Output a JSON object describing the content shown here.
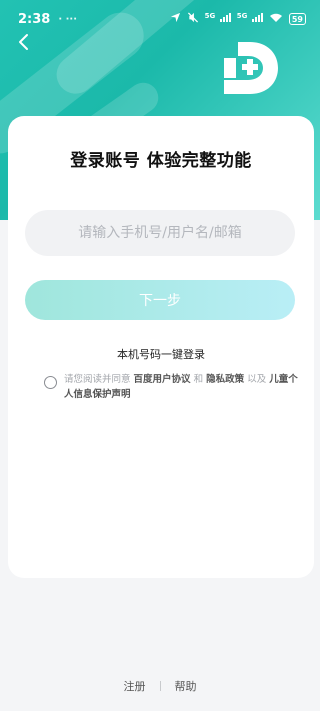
{
  "status_bar": {
    "time": "2:38",
    "indicators": "· ···",
    "network_1": "5G",
    "network_2": "5G",
    "battery": "59"
  },
  "header": {
    "back_icon": "chevron-left-icon",
    "logo_icon": "d-plus-logo-icon"
  },
  "card": {
    "title": "登录账号 体验完整功能",
    "input_placeholder": "请输入手机号/用户名/邮箱",
    "input_value": "",
    "next_button": "下一步",
    "quick_login": "本机号码一键登录",
    "agreement": {
      "prefix": "请您阅读并同意",
      "link1": "百度用户协议",
      "and": "和",
      "link2": "隐私政策",
      "and2": "以及",
      "link3": "儿童个人信息保护声明",
      "checked": false
    }
  },
  "footer": {
    "register": "注册",
    "help": "帮助"
  },
  "colors": {
    "brand_teal": "#1bb9aa",
    "button_gradient_start": "#9fe6dc",
    "button_gradient_end": "#b9eef6"
  }
}
